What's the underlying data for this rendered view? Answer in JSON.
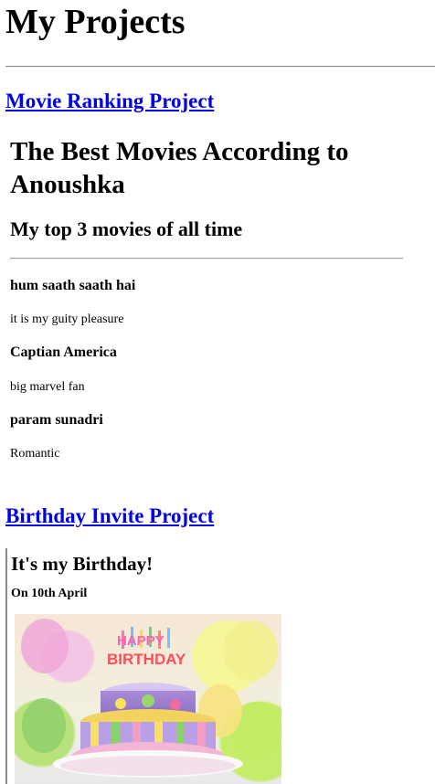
{
  "page": {
    "title": "My Projects"
  },
  "projects": [
    {
      "link_text": "Movie Ranking Project",
      "frame": {
        "heading": "The Best Movies According to Anoushka",
        "subheading": "My top 3 movies of all time",
        "movies": [
          {
            "name": "hum saath saath hai",
            "note": "it is my guity pleasure"
          },
          {
            "name": "Captian America",
            "note": "big marvel fan"
          },
          {
            "name": "param sunadri",
            "note": "Romantic"
          }
        ]
      }
    },
    {
      "link_text": "Birthday Invite Project",
      "frame": {
        "heading": "It's my Birthday!",
        "date": "On 10th April",
        "image_text": "HAPPY BIRTHDAY"
      }
    }
  ],
  "colors": {
    "link": "#0000ee",
    "divider": "#8c8c8c"
  }
}
